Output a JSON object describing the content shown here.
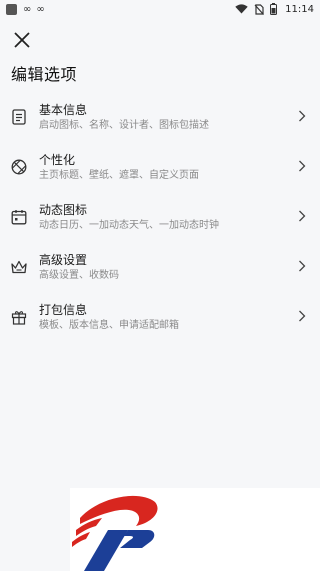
{
  "status_bar": {
    "time": "11:14",
    "left_icons": [
      "app-square-icon",
      "infinity-icon",
      "infinity-icon"
    ],
    "right_icons": [
      "wifi-icon",
      "no-sim-icon",
      "battery-icon"
    ]
  },
  "header": {
    "title": "编辑选项",
    "close_icon": "close-icon"
  },
  "menu": {
    "items": [
      {
        "icon": "document-icon",
        "title": "基本信息",
        "subtitle": "启动图标、名称、设计者、图标包描述"
      },
      {
        "icon": "palette-icon",
        "title": "个性化",
        "subtitle": "主页标题、壁纸、遮罩、自定义页面"
      },
      {
        "icon": "calendar-icon",
        "title": "动态图标",
        "subtitle": "动态日历、一加动态天气、一加动态时钟"
      },
      {
        "icon": "crown-icon",
        "title": "高级设置",
        "subtitle": "高级设置、收数码"
      },
      {
        "icon": "gift-icon",
        "title": "打包信息",
        "subtitle": "模板、版本信息、申请适配邮箱"
      }
    ]
  },
  "colors": {
    "background": "#f6f7f9",
    "logo_red": "#d8261f",
    "logo_blue": "#1c3f97"
  }
}
